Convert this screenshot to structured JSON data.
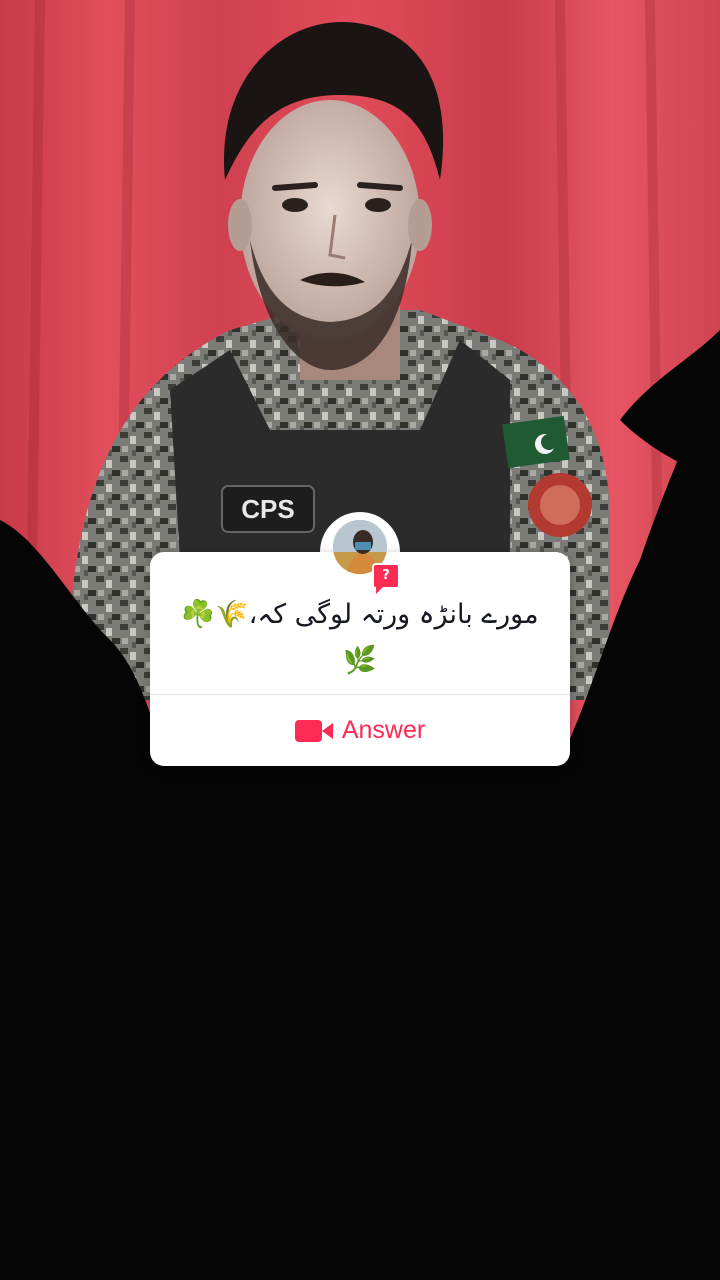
{
  "background": {
    "curtain_color": "#d94452",
    "shadow_color": "#050505"
  },
  "question_sticker": {
    "badge_symbol": "?",
    "question_text": "مورے بانڑہ ورتہ لوگی کہ،🌾☘️ 🌿",
    "answer_label": "Answer",
    "answer_icon": "video-camera-icon",
    "accent_color": "#fe2c55"
  }
}
